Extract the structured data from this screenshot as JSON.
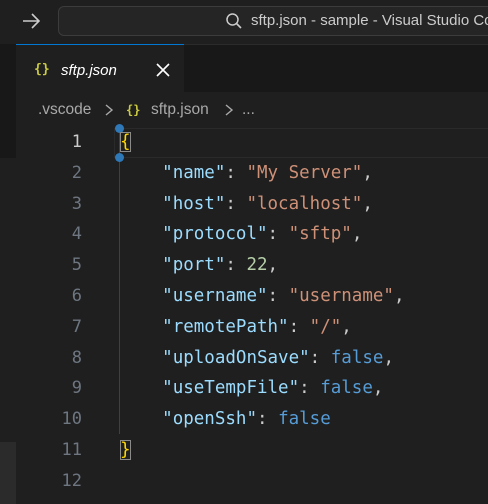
{
  "titlebar": {
    "window_title": "sftp.json - sample - Visual Studio Code"
  },
  "tab": {
    "icon_text": "{}",
    "label": "sftp.json"
  },
  "breadcrumb": {
    "items": [
      ".vscode",
      "sftp.json",
      "..."
    ],
    "file_icon_text": "{}"
  },
  "editor": {
    "active_line": 1,
    "lines": [
      {
        "num": "1",
        "tokens": [
          [
            "brace",
            "{"
          ]
        ]
      },
      {
        "num": "2",
        "tokens": [
          [
            "punc",
            "    "
          ],
          [
            "key",
            "\"name\""
          ],
          [
            "punc",
            ": "
          ],
          [
            "str",
            "\"My Server\""
          ],
          [
            "punc",
            ","
          ]
        ]
      },
      {
        "num": "3",
        "tokens": [
          [
            "punc",
            "    "
          ],
          [
            "key",
            "\"host\""
          ],
          [
            "punc",
            ": "
          ],
          [
            "str",
            "\"localhost\""
          ],
          [
            "punc",
            ","
          ]
        ]
      },
      {
        "num": "4",
        "tokens": [
          [
            "punc",
            "    "
          ],
          [
            "key",
            "\"protocol\""
          ],
          [
            "punc",
            ": "
          ],
          [
            "str",
            "\"sftp\""
          ],
          [
            "punc",
            ","
          ]
        ]
      },
      {
        "num": "5",
        "tokens": [
          [
            "punc",
            "    "
          ],
          [
            "key",
            "\"port\""
          ],
          [
            "punc",
            ": "
          ],
          [
            "num",
            "22"
          ],
          [
            "punc",
            ","
          ]
        ]
      },
      {
        "num": "6",
        "tokens": [
          [
            "punc",
            "    "
          ],
          [
            "key",
            "\"username\""
          ],
          [
            "punc",
            ": "
          ],
          [
            "str",
            "\"username\""
          ],
          [
            "punc",
            ","
          ]
        ]
      },
      {
        "num": "7",
        "tokens": [
          [
            "punc",
            "    "
          ],
          [
            "key",
            "\"remotePath\""
          ],
          [
            "punc",
            ": "
          ],
          [
            "str",
            "\"/\""
          ],
          [
            "punc",
            ","
          ]
        ]
      },
      {
        "num": "8",
        "tokens": [
          [
            "punc",
            "    "
          ],
          [
            "key",
            "\"uploadOnSave\""
          ],
          [
            "punc",
            ": "
          ],
          [
            "kw",
            "false"
          ],
          [
            "punc",
            ","
          ]
        ]
      },
      {
        "num": "9",
        "tokens": [
          [
            "punc",
            "    "
          ],
          [
            "key",
            "\"useTempFile\""
          ],
          [
            "punc",
            ": "
          ],
          [
            "kw",
            "false"
          ],
          [
            "punc",
            ","
          ]
        ]
      },
      {
        "num": "10",
        "tokens": [
          [
            "punc",
            "    "
          ],
          [
            "key",
            "\"openSsh\""
          ],
          [
            "punc",
            ": "
          ],
          [
            "kw",
            "false"
          ]
        ]
      },
      {
        "num": "11",
        "tokens": [
          [
            "brace",
            "}"
          ]
        ]
      },
      {
        "num": "12",
        "tokens": []
      }
    ]
  },
  "icons": {
    "back": "arrow-right-icon",
    "search": "search-icon",
    "close": "close-icon",
    "separator": "chevron-right-icon"
  },
  "colors": {
    "background": "#1f1f1f",
    "key": "#9cdcfe",
    "string": "#ce9178",
    "number": "#b5cea8",
    "keyword": "#569cd6",
    "brace": "#ffd700",
    "json_icon": "#cbcb41",
    "accent": "#0078d4"
  }
}
